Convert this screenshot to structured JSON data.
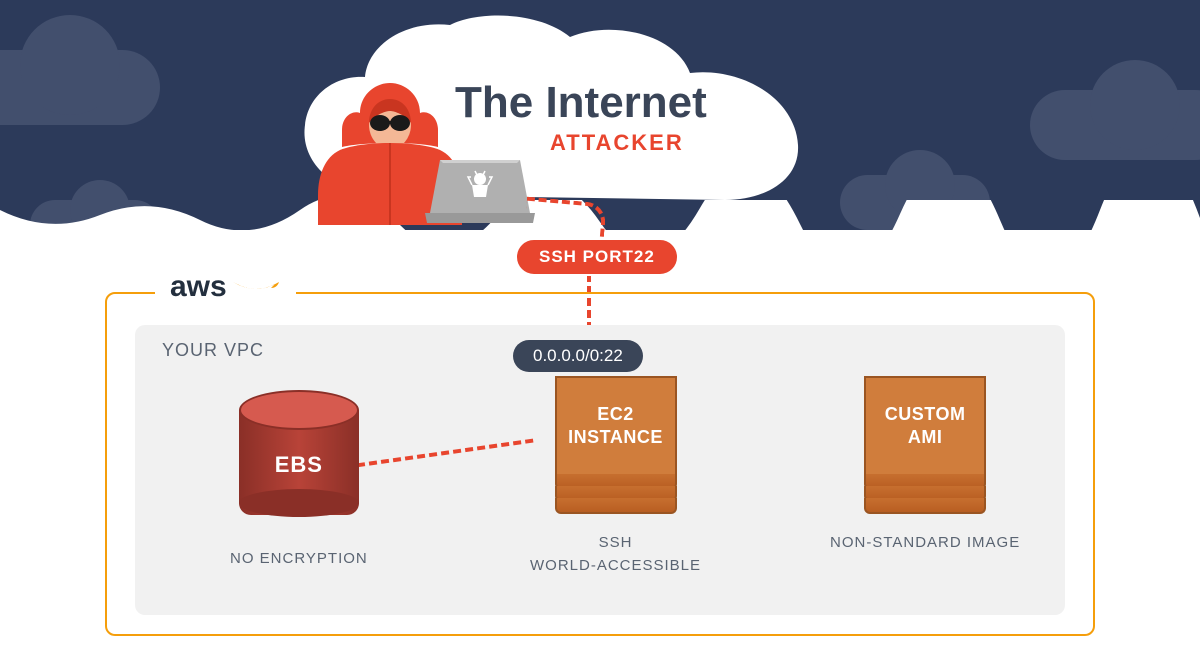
{
  "internet": {
    "title": "The Internet",
    "attacker_label": "ATTACKER"
  },
  "ssh_badge": "SSH PORT22",
  "aws": {
    "label": "aws"
  },
  "vpc": {
    "label": "YOUR VPC",
    "cidr": "0.0.0.0/0:22"
  },
  "resources": {
    "ebs": {
      "label": "EBS",
      "caption": "NO ENCRYPTION"
    },
    "ec2": {
      "label_line1": "EC2",
      "label_line2": "INSTANCE",
      "caption_line1": "SSH",
      "caption_line2": "WORLD-ACCESSIBLE"
    },
    "ami": {
      "label_line1": "CUSTOM",
      "label_line2": "AMI",
      "caption": "NON-STANDARD IMAGE"
    }
  }
}
